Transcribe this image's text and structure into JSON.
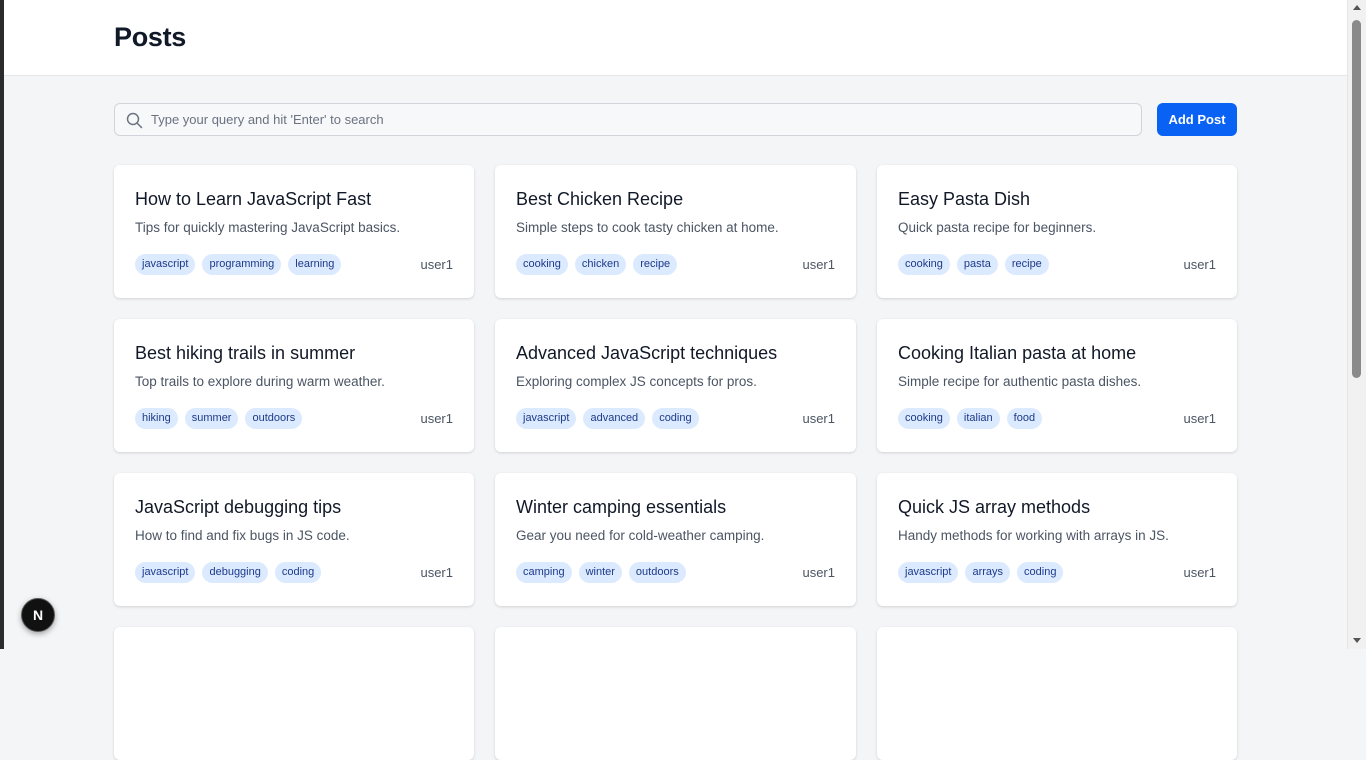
{
  "header": {
    "title": "Posts"
  },
  "search": {
    "placeholder": "Type your query and hit 'Enter' to search",
    "value": ""
  },
  "toolbar": {
    "add_label": "Add Post"
  },
  "dev_badge": {
    "letter": "N"
  },
  "posts": [
    {
      "title": "How to Learn JavaScript Fast",
      "description": "Tips for quickly mastering JavaScript basics.",
      "tags": [
        "javascript",
        "programming",
        "learning"
      ],
      "author": "user1"
    },
    {
      "title": "Best Chicken Recipe",
      "description": "Simple steps to cook tasty chicken at home.",
      "tags": [
        "cooking",
        "chicken",
        "recipe"
      ],
      "author": "user1"
    },
    {
      "title": "Easy Pasta Dish",
      "description": "Quick pasta recipe for beginners.",
      "tags": [
        "cooking",
        "pasta",
        "recipe"
      ],
      "author": "user1"
    },
    {
      "title": "Best hiking trails in summer",
      "description": "Top trails to explore during warm weather.",
      "tags": [
        "hiking",
        "summer",
        "outdoors"
      ],
      "author": "user1"
    },
    {
      "title": "Advanced JavaScript techniques",
      "description": "Exploring complex JS concepts for pros.",
      "tags": [
        "javascript",
        "advanced",
        "coding"
      ],
      "author": "user1"
    },
    {
      "title": "Cooking Italian pasta at home",
      "description": "Simple recipe for authentic pasta dishes.",
      "tags": [
        "cooking",
        "italian",
        "food"
      ],
      "author": "user1"
    },
    {
      "title": "JavaScript debugging tips",
      "description": "How to find and fix bugs in JS code.",
      "tags": [
        "javascript",
        "debugging",
        "coding"
      ],
      "author": "user1"
    },
    {
      "title": "Winter camping essentials",
      "description": "Gear you need for cold-weather camping.",
      "tags": [
        "camping",
        "winter",
        "outdoors"
      ],
      "author": "user1"
    },
    {
      "title": "Quick JS array methods",
      "description": "Handy methods for working with arrays in JS.",
      "tags": [
        "javascript",
        "arrays",
        "coding"
      ],
      "author": "user1"
    }
  ]
}
